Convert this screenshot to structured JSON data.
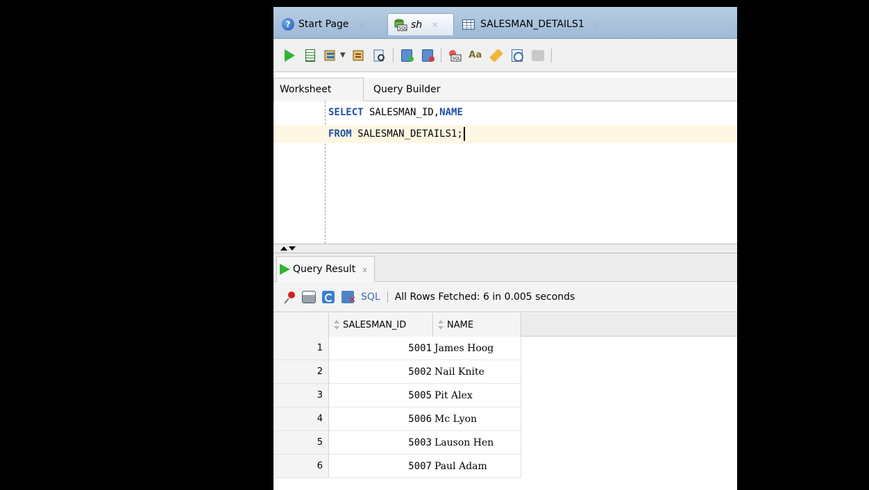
{
  "tabs": [
    {
      "label": "Start Page",
      "icon": "help-icon"
    },
    {
      "label": "sh",
      "icon": "sql-connection-icon"
    },
    {
      "label": "SALESMAN_DETAILS1",
      "icon": "table-icon"
    }
  ],
  "tab_close_glyph": "×",
  "subtabs": {
    "worksheet": "Worksheet",
    "query_builder": "Query Builder"
  },
  "editor": {
    "line1": {
      "kw": "SELECT",
      "rest_a": " SALESMAN_ID,",
      "kw2": "NAME"
    },
    "line2": {
      "kw": "FROM",
      "rest": " SALESMAN_DETAILS1;"
    }
  },
  "result": {
    "tab_label": "Query Result",
    "tab_close": "x",
    "sql_label": "SQL",
    "status": "All Rows Fetched: 6 in 0.005 seconds",
    "columns": [
      "SALESMAN_ID",
      "NAME"
    ],
    "rows": [
      {
        "n": "1",
        "id": "5001",
        "name": "James Hoog"
      },
      {
        "n": "2",
        "id": "5002",
        "name": "Nail Knite"
      },
      {
        "n": "3",
        "id": "5005",
        "name": "Pit Alex"
      },
      {
        "n": "4",
        "id": "5006",
        "name": "Mc Lyon"
      },
      {
        "n": "5",
        "id": "5003",
        "name": "Lauson Hen"
      },
      {
        "n": "6",
        "id": "5007",
        "name": "Paul Adam"
      }
    ]
  },
  "toolbar_icons": [
    "run-statement-icon",
    "run-script-icon",
    "autotrace-icon",
    "explain-plan-icon",
    "sql-tuning-icon",
    "commit-icon",
    "rollback-icon",
    "unshared-sql-icon",
    "format-case-icon",
    "clear-icon",
    "sql-history-icon",
    "tuning-advisor-icon"
  ],
  "colors": {
    "keyword": "#1f4fa6",
    "current_line": "#fdf7e3",
    "run_green": "#2fb531",
    "tabbar": "#9fb9d6"
  }
}
